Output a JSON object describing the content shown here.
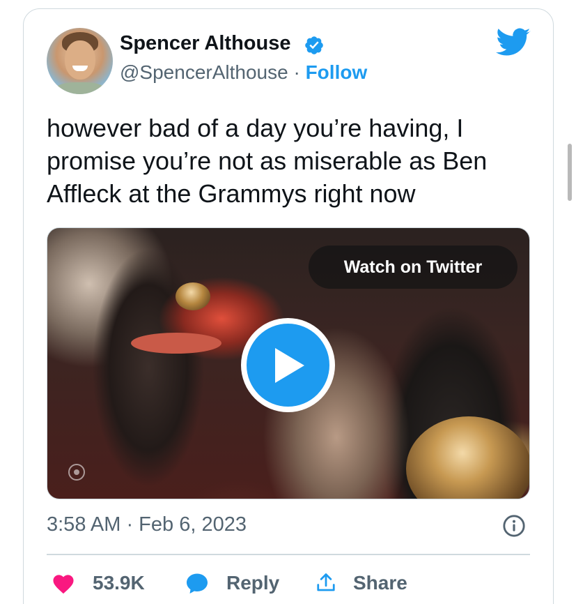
{
  "author": {
    "name": "Spencer Althouse",
    "handle": "@SpencerAlthouse",
    "separator": "·",
    "follow_label": "Follow",
    "verified": true
  },
  "tweet": {
    "text": "however bad of a day you’re having, I promise you’re not as miserable as Ben Affleck at the Grammys right now",
    "timestamp": "3:58 AM · Feb 6, 2023"
  },
  "media": {
    "type": "video",
    "watch_label": "Watch on Twitter",
    "play_icon": "play-icon"
  },
  "actions": {
    "likes_count": "53.9K",
    "reply_label": "Reply",
    "share_label": "Share"
  },
  "icons": {
    "brand": "twitter-bird-icon",
    "verified": "verified-badge-icon",
    "info": "info-icon",
    "like": "heart-icon",
    "reply": "speech-bubble-icon",
    "share": "share-upload-icon"
  },
  "colors": {
    "brand_blue": "#1d9bf0",
    "like_pink": "#f91880",
    "text_primary": "#0f1419",
    "text_secondary": "#536471",
    "border": "#cfd9de"
  }
}
